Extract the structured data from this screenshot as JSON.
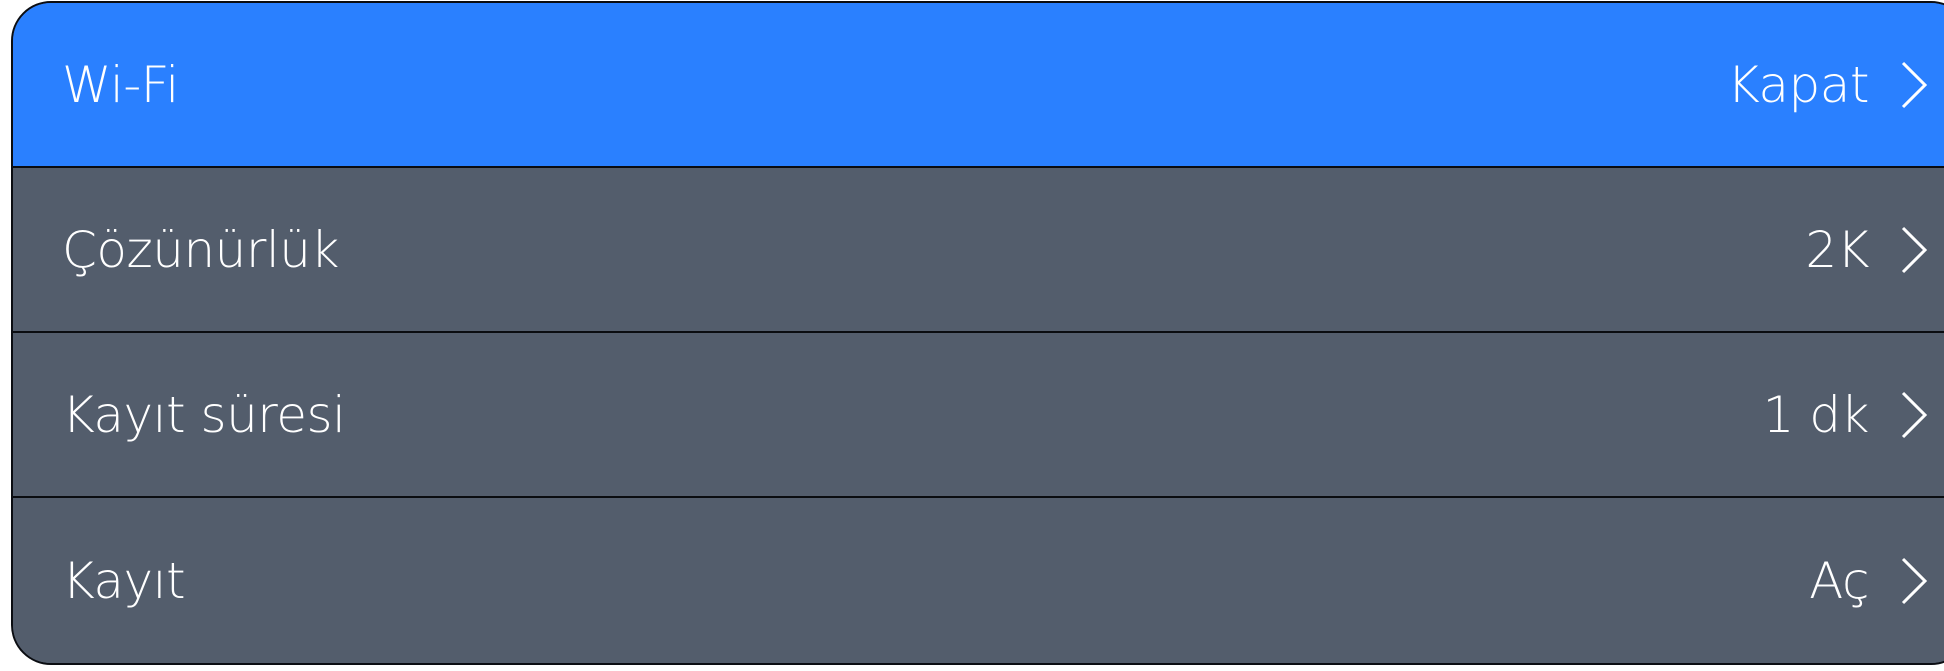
{
  "settings": {
    "items": [
      {
        "label": "Wi-Fi",
        "value": "Kapat",
        "selected": true
      },
      {
        "label": "Çözünürlük",
        "value": "2K",
        "selected": false
      },
      {
        "label": "Kayıt süresi",
        "value": "1 dk",
        "selected": false
      },
      {
        "label": "Kayıt",
        "value": "Aç",
        "selected": false
      }
    ]
  },
  "colors": {
    "selected_row": "#2a80ff",
    "row": "#535d6c",
    "text": "#ffffff",
    "divider": "#0a0c10"
  },
  "icons": {
    "row_arrow": "chevron-right-icon"
  }
}
